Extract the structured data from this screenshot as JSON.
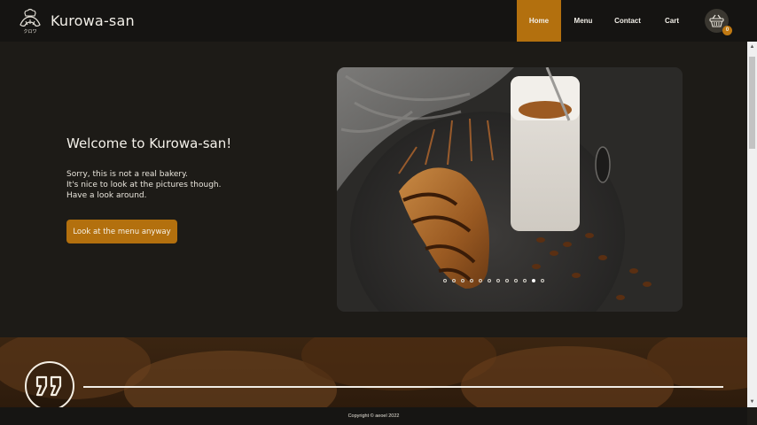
{
  "header": {
    "brand": "Kurowa-san",
    "nav": [
      {
        "label": "Home",
        "active": true
      },
      {
        "label": "Menu",
        "active": false
      },
      {
        "label": "Contact",
        "active": false
      },
      {
        "label": "Cart",
        "active": false
      }
    ],
    "cart_count": "0",
    "logo_text": "クロワ"
  },
  "hero": {
    "title": "Welcome to Kurowa-san!",
    "lines": [
      "Sorry, this is not a real bakery.",
      "It's nice to look at the pictures though.",
      "Have a look around."
    ],
    "button": "Look at the menu anyway"
  },
  "carousel": {
    "slide_count": 12,
    "active_index": 10
  },
  "footer": {
    "copyright": "Copyright © aeoel 2022"
  },
  "colors": {
    "accent": "#b3700e",
    "background": "#1d1b17",
    "header": "#151412"
  },
  "icons": {
    "logo": "croissant-chef-icon",
    "cart": "basket-icon",
    "quote": "quote-icon"
  }
}
